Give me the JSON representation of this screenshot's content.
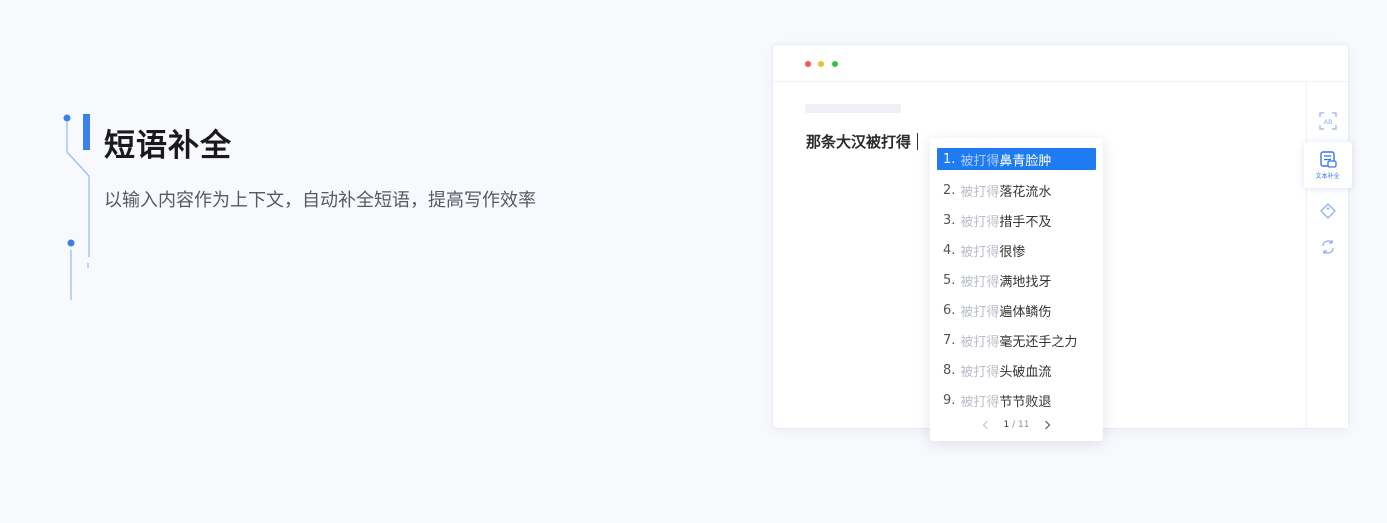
{
  "feature": {
    "title": "短语补全",
    "description": "以输入内容作为上下文，自动补全短语，提高写作效率"
  },
  "editor": {
    "text": "那条大汉被打得"
  },
  "toolbar": {
    "active_tool_label": "文本补全",
    "tools": [
      "ab-icon",
      "text-complete-icon",
      "tag-icon",
      "refresh-icon"
    ]
  },
  "suggestions": {
    "selected_index": 0,
    "items": [
      {
        "num": "1.",
        "prefix": "被打得",
        "text": "鼻青脸肿"
      },
      {
        "num": "2.",
        "prefix": "被打得",
        "text": "落花流水"
      },
      {
        "num": "3.",
        "prefix": "被打得",
        "text": "措手不及"
      },
      {
        "num": "4.",
        "prefix": "被打得",
        "text": "很惨"
      },
      {
        "num": "5.",
        "prefix": "被打得",
        "text": "满地找牙"
      },
      {
        "num": "6.",
        "prefix": "被打得",
        "text": "遍体鳞伤"
      },
      {
        "num": "7.",
        "prefix": "被打得",
        "text": "毫无还手之力"
      },
      {
        "num": "8.",
        "prefix": "被打得",
        "text": "头破血流"
      },
      {
        "num": "9.",
        "prefix": "被打得",
        "text": "节节败退"
      }
    ],
    "pagination": {
      "current": "1",
      "separator": "/",
      "total": "11"
    }
  },
  "colors": {
    "accent": "#1e7bf2",
    "deco_line": "#3b82e8",
    "dot_red": "#f35a53",
    "dot_yellow": "#f7bb32",
    "dot_green": "#37c247"
  }
}
